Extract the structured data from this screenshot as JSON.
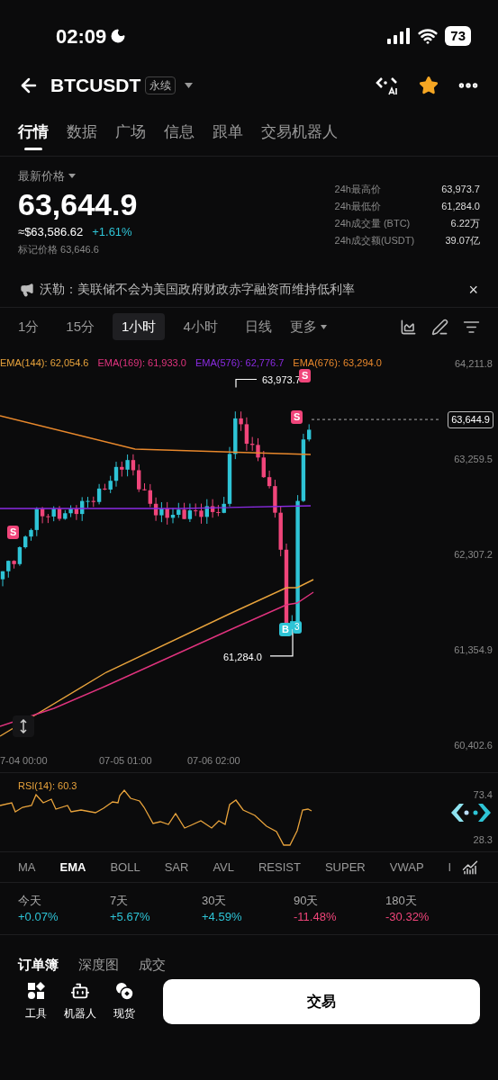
{
  "status_bar": {
    "time": "02:09",
    "battery": "73"
  },
  "header": {
    "symbol": "BTCUSDT",
    "badge": "永续",
    "favorite": true
  },
  "tabs": [
    {
      "label": "行情",
      "selected": true
    },
    {
      "label": "数据",
      "selected": false
    },
    {
      "label": "广场",
      "selected": false
    },
    {
      "label": "信息",
      "selected": false
    },
    {
      "label": "跟单",
      "selected": false
    },
    {
      "label": "交易机器人",
      "selected": false
    }
  ],
  "price": {
    "label": "最新价格",
    "last": "63,644.9",
    "usd": "≈$63,586.62",
    "change": "+1.61%",
    "mark": "标记价格 63,646.6"
  },
  "stats": [
    {
      "label": "24h最高价",
      "value": "63,973.7"
    },
    {
      "label": "24h最低价",
      "value": "61,284.0"
    },
    {
      "label": "24h成交量 (BTC)",
      "value": "6.22万"
    },
    {
      "label": "24h成交额(USDT)",
      "value": "39.07亿"
    }
  ],
  "news": {
    "text": "沃勒：美联储不会为美国政府财政赤字融资而维持低利率",
    "close": "×"
  },
  "timeframes": [
    {
      "label": "1分",
      "selected": false
    },
    {
      "label": "15分",
      "selected": false
    },
    {
      "label": "1小时",
      "selected": true
    },
    {
      "label": "4小时",
      "selected": false
    },
    {
      "label": "日线",
      "selected": false
    }
  ],
  "more": "更多",
  "chart": {
    "legend": [
      {
        "label": "EMA(144): 62,054.6",
        "color": "#e8a33c"
      },
      {
        "label": "EMA(169): 61,933.0",
        "color": "#e0337e"
      },
      {
        "label": "EMA(576): 62,776.7",
        "color": "#8a2be2"
      },
      {
        "label": "EMA(676): 63,294.0",
        "color": "#e8882c"
      }
    ],
    "y_labels": [
      "64,211.8",
      "63,259.5",
      "62,307.2",
      "61,354.9",
      "60,402.6"
    ],
    "x_labels": [
      "7-04 00:00",
      "07-05 01:00",
      "07-06 02:00"
    ],
    "high_label": "63,973.7",
    "low_label": "61,284.0",
    "current_price": "63,644.9",
    "markers": [
      {
        "kind": "sell",
        "text": "S"
      },
      {
        "kind": "sell",
        "text": "S"
      },
      {
        "kind": "sell",
        "text": "S"
      },
      {
        "kind": "buy",
        "text": "B",
        "count": "3"
      }
    ]
  },
  "rsi": {
    "label": "RSI(14): 60.3",
    "high": "73.4",
    "low": "28.3"
  },
  "indicators": [
    {
      "label": "MA",
      "selected": false
    },
    {
      "label": "EMA",
      "selected": true
    },
    {
      "label": "BOLL",
      "selected": false
    },
    {
      "label": "SAR",
      "selected": false
    },
    {
      "label": "AVL",
      "selected": false
    },
    {
      "label": "RESIST",
      "selected": false
    },
    {
      "label": "SUPER",
      "selected": false
    },
    {
      "label": "VWAP",
      "selected": false
    },
    {
      "label": "I",
      "selected": false
    }
  ],
  "performance": [
    {
      "period": "今天",
      "change": "+0.07%",
      "color": "#2ec4d6"
    },
    {
      "period": "7天",
      "change": "+5.67%",
      "color": "#2ec4d6"
    },
    {
      "period": "30天",
      "change": "+4.59%",
      "color": "#2ec4d6"
    },
    {
      "period": "90天",
      "change": "-11.48%",
      "color": "#f0457a"
    },
    {
      "period": "180天",
      "change": "-30.32%",
      "color": "#f0457a"
    }
  ],
  "book_tabs": [
    {
      "label": "订单簿",
      "selected": true
    },
    {
      "label": "深度图",
      "selected": false
    },
    {
      "label": "成交",
      "selected": false
    }
  ],
  "actions": [
    {
      "kind": "tools",
      "label": "工具"
    },
    {
      "kind": "robot",
      "label": "机器人"
    },
    {
      "kind": "spot",
      "label": "现货"
    }
  ],
  "trade_button": "交易"
}
